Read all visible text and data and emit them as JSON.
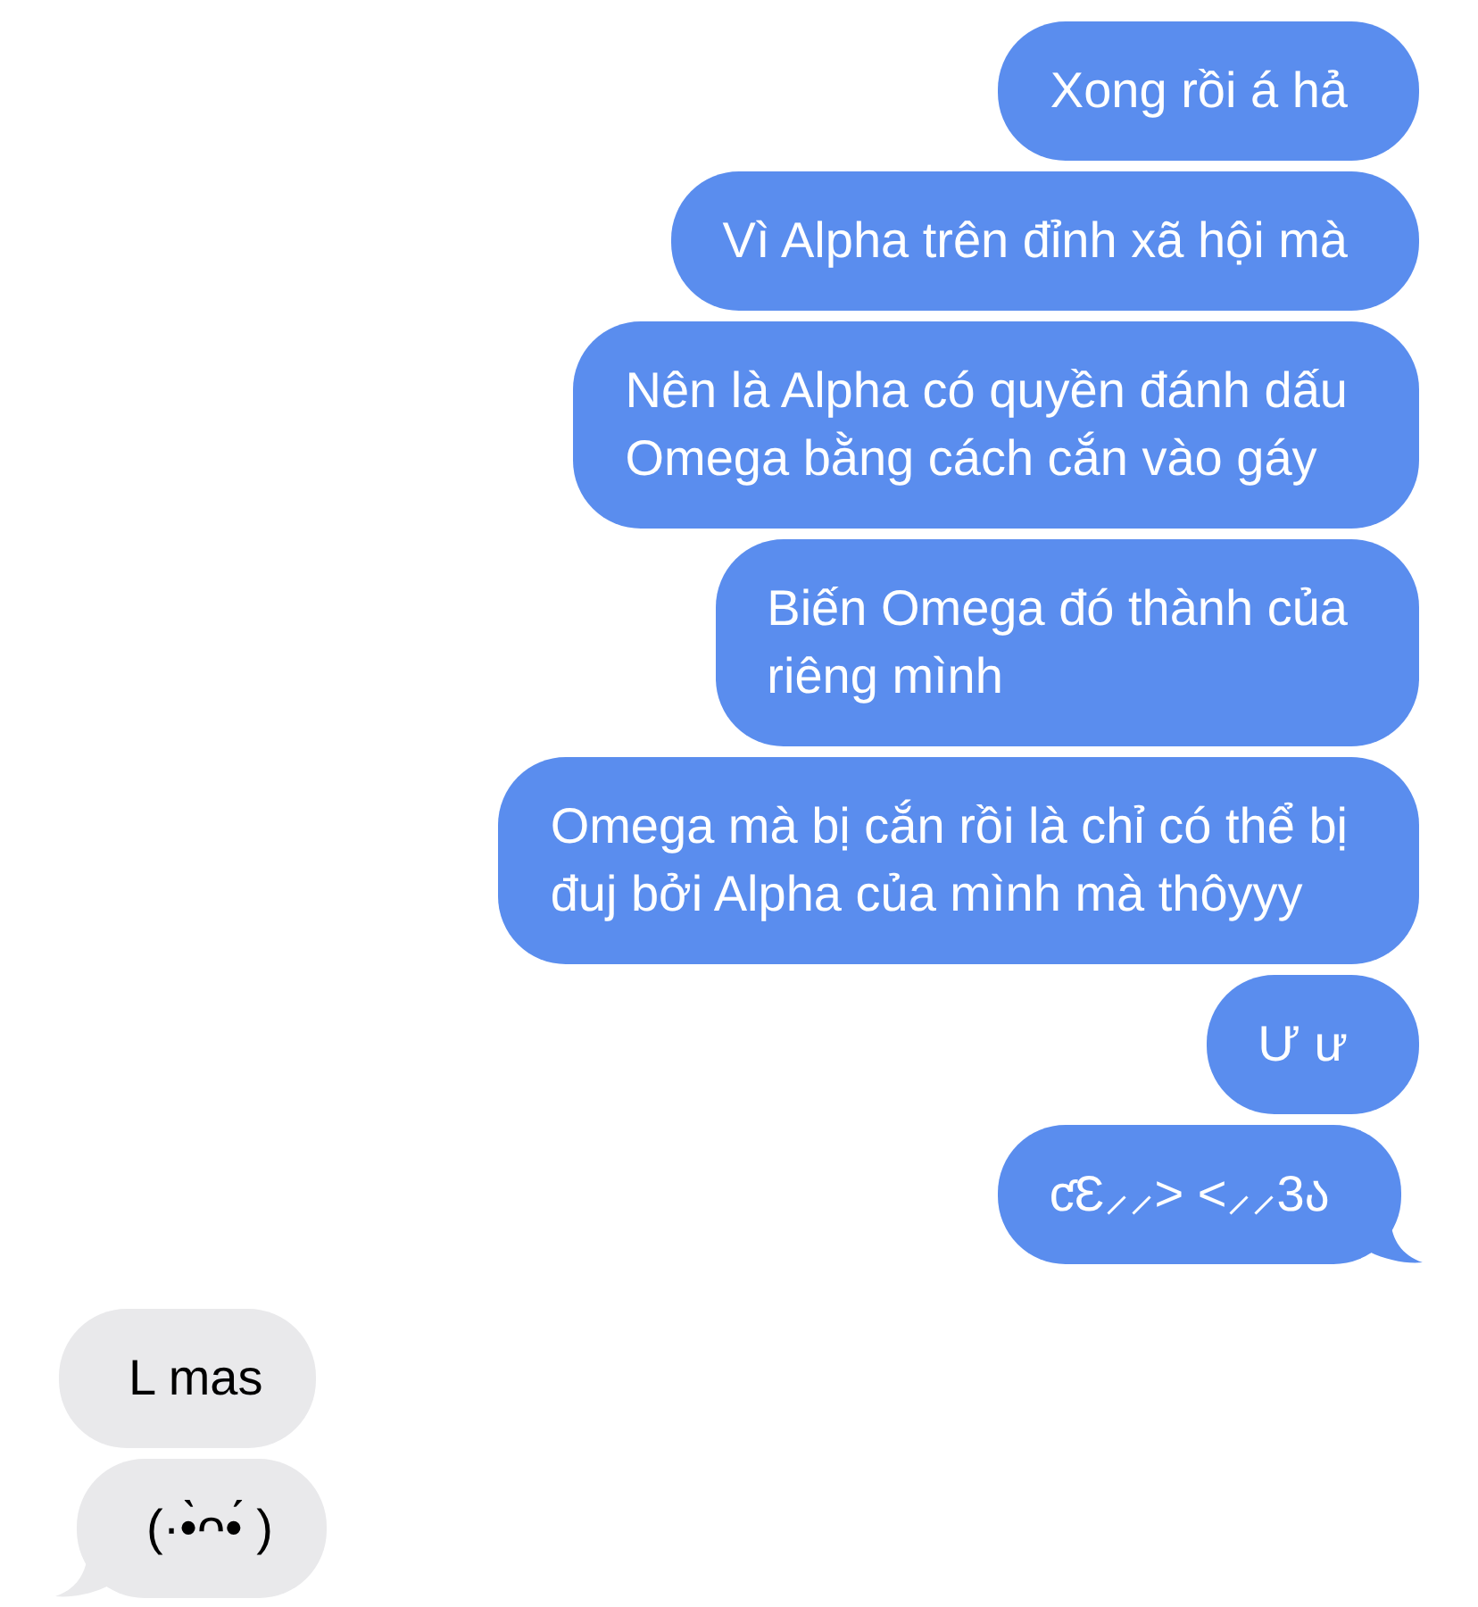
{
  "messages": [
    {
      "kind": "outgoing",
      "text": "Xong rồi á hả",
      "tail": false
    },
    {
      "kind": "outgoing",
      "text": "Vì Alpha trên đỉnh xã hội mà",
      "tail": false
    },
    {
      "kind": "outgoing",
      "text": "Nên là Alpha có quyền đánh dấu\nOmega bằng cách cắn vào gáy",
      "tail": false
    },
    {
      "kind": "outgoing",
      "text": "Biến Omega đó thành của\nriêng mình",
      "tail": false
    },
    {
      "kind": "outgoing",
      "text": "Omega mà bị cắn rồi là chỉ có thể bị\nđuj bởi Alpha của mình mà thôyyy",
      "tail": false
    },
    {
      "kind": "outgoing",
      "text": "Ư ư",
      "tail": false
    },
    {
      "kind": "outgoing",
      "text": "ƈƐ⸝⸝> <⸝⸝3ა",
      "tail": true
    },
    {
      "kind": "incoming",
      "text": "L mas",
      "tail": false
    },
    {
      "kind": "incoming",
      "text": "(·•̀ᴖ•́ )",
      "tail": true
    }
  ]
}
